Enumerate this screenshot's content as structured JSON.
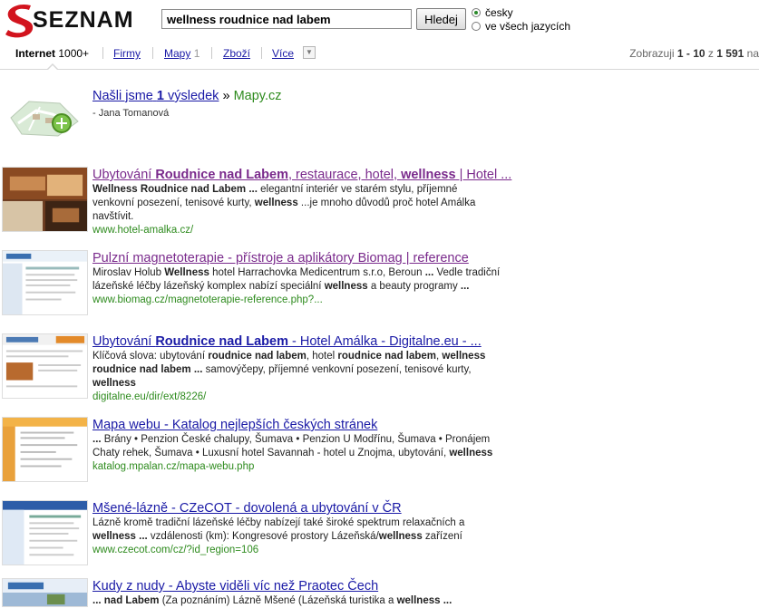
{
  "logo_text": "SEZNAM",
  "search": {
    "query": "wellness roudnice nad labem",
    "button": "Hledej"
  },
  "lang": {
    "cz": "česky",
    "all": "ve všech jazycích"
  },
  "nav": {
    "internet": "Internet",
    "internet_count": "1000+",
    "firmy": "Firmy",
    "mapy": "Mapy",
    "mapy_count": "1",
    "zbozi": "Zboží",
    "vice": "Více"
  },
  "results_info": {
    "prefix": "Zobrazuji",
    "range": "1 - 10",
    "of": "z",
    "total": "1 591",
    "suffix": "na"
  },
  "maps_box": {
    "found_a": "Našli jsme",
    "found_n": "1",
    "found_b": "výsledek",
    "sep": "»",
    "site": "Mapy.cz",
    "author": "- Jana Tomanová"
  },
  "results": [
    {
      "title": [
        {
          "t": "Ubytování "
        },
        {
          "t": "Roudnice nad Labem",
          "b": true
        },
        {
          "t": ", restaurace, hotel, "
        },
        {
          "t": "wellness",
          "b": true
        },
        {
          "t": " | Hotel ..."
        }
      ],
      "snippet": [
        {
          "t": "Wellness Roudnice nad Labem ...",
          "b": true
        },
        {
          "t": " elegantní interiér ve starém stylu, příjemné venkovní posezení, tenisové kurty, "
        },
        {
          "t": "wellness",
          "b": true
        },
        {
          "t": " ...je mnoho důvodů proč hotel Amálka navštívit."
        }
      ],
      "url": "www.hotel-amalka.cz/",
      "visited": true
    },
    {
      "title": [
        {
          "t": "Pulzní magnetoterapie - přístroje a aplikátory Biomag | reference"
        }
      ],
      "snippet": [
        {
          "t": "Miroslav Holub "
        },
        {
          "t": "Wellness",
          "b": true
        },
        {
          "t": " hotel Harrachovka Medicentrum s.r.o, Beroun "
        },
        {
          "t": "...",
          "b": true
        },
        {
          "t": " Vedle tradiční lázeňské léčby lázeňský komplex nabízí speciální "
        },
        {
          "t": "wellness",
          "b": true
        },
        {
          "t": " a beauty programy "
        },
        {
          "t": "...",
          "b": true
        }
      ],
      "url": "www.biomag.cz/magnetoterapie-reference.php?...",
      "visited": true
    },
    {
      "title": [
        {
          "t": "Ubytování "
        },
        {
          "t": "Roudnice nad Labem",
          "b": true
        },
        {
          "t": " - Hotel Amálka - Digitalne.eu - ..."
        }
      ],
      "snippet": [
        {
          "t": "Klíčová slova: ubytování "
        },
        {
          "t": "roudnice nad labem",
          "b": true
        },
        {
          "t": ", hotel "
        },
        {
          "t": "roudnice nad labem",
          "b": true
        },
        {
          "t": ", "
        },
        {
          "t": "wellness roudnice nad labem ...",
          "b": true
        },
        {
          "t": " samovýčepy, příjemné venkovní posezení, tenisové kurty, "
        },
        {
          "t": "wellness",
          "b": true
        }
      ],
      "url": "digitalne.eu/dir/ext/8226/",
      "visited": false
    },
    {
      "title": [
        {
          "t": "Mapa webu - Katalog nejlepších českých stránek"
        }
      ],
      "snippet": [
        {
          "t": "...",
          "b": true
        },
        {
          "t": " Brány • Penzion České chalupy, Šumava • Penzion U Modřínu, Šumava • Pronájem Chaty rehek, Šumava • Luxusní hotel Savannah - hotel u Znojma, ubytování, "
        },
        {
          "t": "wellness",
          "b": true
        }
      ],
      "url": "katalog.mpalan.cz/mapa-webu.php",
      "visited": false
    },
    {
      "title": [
        {
          "t": "Mšené-lázně - CZeCOT - dovolená a ubytování v ČR"
        }
      ],
      "snippet": [
        {
          "t": "Lázně kromě tradiční lázeňské léčby nabízejí také široké spektrum relaxačních a "
        },
        {
          "t": "wellness ...",
          "b": true
        },
        {
          "t": " vzdálenosti (km): Kongresové prostory Lázeňská/"
        },
        {
          "t": "wellness",
          "b": true
        },
        {
          "t": " zařízení"
        }
      ],
      "url": "www.czecot.com/cz/?id_region=106",
      "visited": false
    },
    {
      "title": [
        {
          "t": "Kudy z nudy - Abyste viděli víc než Praotec Čech"
        }
      ],
      "snippet": [
        {
          "t": "... nad Labem",
          "b": true
        },
        {
          "t": " (Za poznáním) Lázně Mšené (Lázeňská turistika a "
        },
        {
          "t": "wellness ...",
          "b": true
        }
      ],
      "url": "",
      "visited": false
    }
  ]
}
